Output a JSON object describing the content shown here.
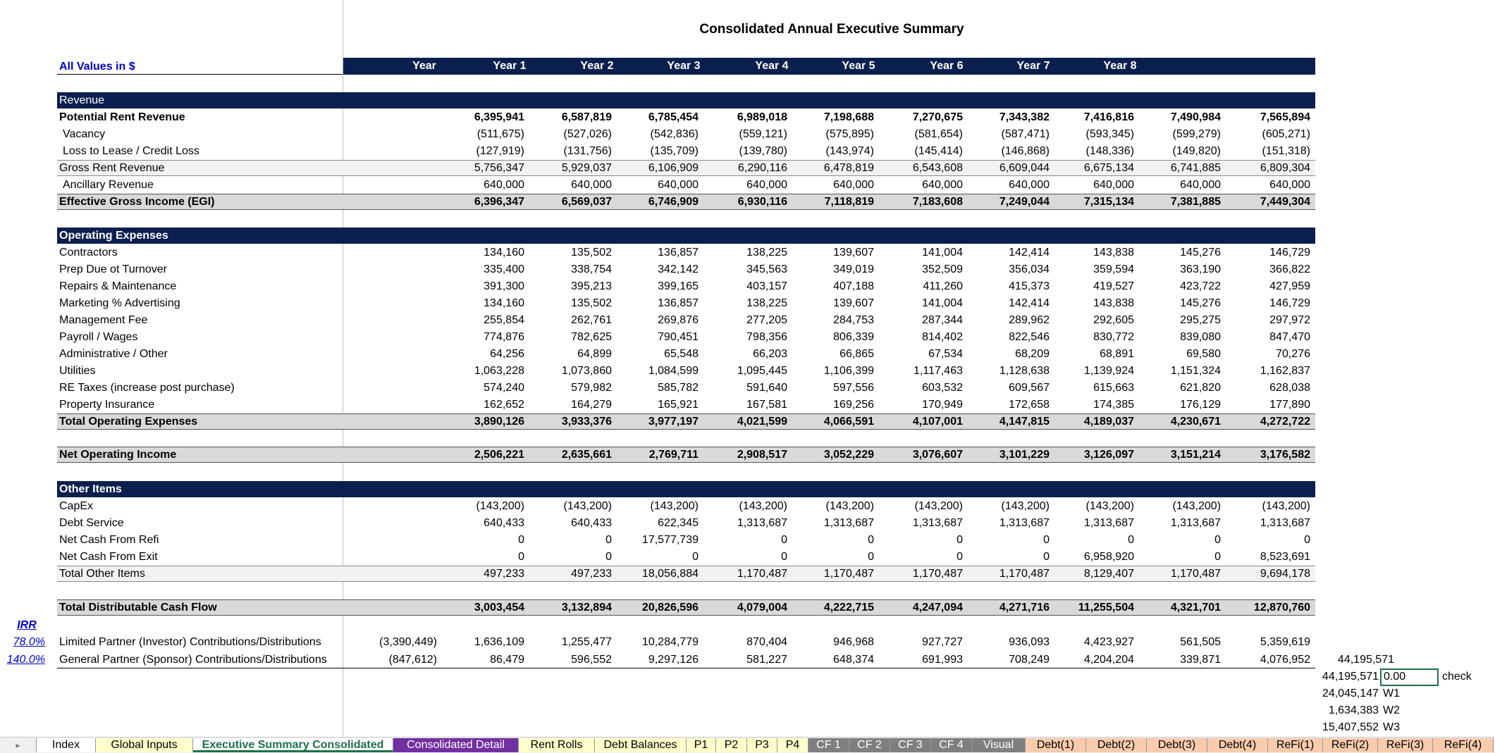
{
  "title": "Consolidated Annual Executive Summary",
  "units_label": "All Values in $",
  "year_header": [
    "Year",
    "Year 1",
    "Year 2",
    "Year 3",
    "Year 4",
    "Year 5",
    "Year 6",
    "Year 7",
    "Year 8"
  ],
  "revenue": {
    "header": "Revenue",
    "rows": [
      {
        "label": "Potential Rent Revenue",
        "values": [
          "6,395,941",
          "6,587,819",
          "6,785,454",
          "6,989,018",
          "7,198,688",
          "7,270,675",
          "7,343,382",
          "7,416,816",
          "7,490,984",
          "7,565,894"
        ]
      },
      {
        "label": "Vacancy",
        "values": [
          "(511,675)",
          "(527,026)",
          "(542,836)",
          "(559,121)",
          "(575,895)",
          "(581,654)",
          "(587,471)",
          "(593,345)",
          "(599,279)",
          "(605,271)"
        ]
      },
      {
        "label": "Loss to Lease / Credit Loss",
        "values": [
          "(127,919)",
          "(131,756)",
          "(135,709)",
          "(139,780)",
          "(143,974)",
          "(145,414)",
          "(146,868)",
          "(148,336)",
          "(149,820)",
          "(151,318)"
        ]
      },
      {
        "label": "Gross Rent Revenue",
        "values": [
          "5,756,347",
          "5,929,037",
          "6,106,909",
          "6,290,116",
          "6,478,819",
          "6,543,608",
          "6,609,044",
          "6,675,134",
          "6,741,885",
          "6,809,304"
        ]
      },
      {
        "label": "Ancillary Revenue",
        "values": [
          "640,000",
          "640,000",
          "640,000",
          "640,000",
          "640,000",
          "640,000",
          "640,000",
          "640,000",
          "640,000",
          "640,000"
        ]
      },
      {
        "label": "Effective Gross Income (EGI)",
        "values": [
          "6,396,347",
          "6,569,037",
          "6,746,909",
          "6,930,116",
          "7,118,819",
          "7,183,608",
          "7,249,044",
          "7,315,134",
          "7,381,885",
          "7,449,304"
        ]
      }
    ]
  },
  "opex": {
    "header": "Operating Expenses",
    "rows": [
      {
        "label": "Contractors",
        "values": [
          "134,160",
          "135,502",
          "136,857",
          "138,225",
          "139,607",
          "141,004",
          "142,414",
          "143,838",
          "145,276",
          "146,729"
        ]
      },
      {
        "label": "Prep Due ot Turnover",
        "values": [
          "335,400",
          "338,754",
          "342,142",
          "345,563",
          "349,019",
          "352,509",
          "356,034",
          "359,594",
          "363,190",
          "366,822"
        ]
      },
      {
        "label": "Repairs & Maintenance",
        "values": [
          "391,300",
          "395,213",
          "399,165",
          "403,157",
          "407,188",
          "411,260",
          "415,373",
          "419,527",
          "423,722",
          "427,959"
        ]
      },
      {
        "label": "Marketing % Advertising",
        "values": [
          "134,160",
          "135,502",
          "136,857",
          "138,225",
          "139,607",
          "141,004",
          "142,414",
          "143,838",
          "145,276",
          "146,729"
        ]
      },
      {
        "label": "Management Fee",
        "values": [
          "255,854",
          "262,761",
          "269,876",
          "277,205",
          "284,753",
          "287,344",
          "289,962",
          "292,605",
          "295,275",
          "297,972"
        ]
      },
      {
        "label": "Payroll / Wages",
        "values": [
          "774,876",
          "782,625",
          "790,451",
          "798,356",
          "806,339",
          "814,402",
          "822,546",
          "830,772",
          "839,080",
          "847,470"
        ]
      },
      {
        "label": "Administrative / Other",
        "values": [
          "64,256",
          "64,899",
          "65,548",
          "66,203",
          "66,865",
          "67,534",
          "68,209",
          "68,891",
          "69,580",
          "70,276"
        ]
      },
      {
        "label": "Utilities",
        "values": [
          "1,063,228",
          "1,073,860",
          "1,084,599",
          "1,095,445",
          "1,106,399",
          "1,117,463",
          "1,128,638",
          "1,139,924",
          "1,151,324",
          "1,162,837"
        ]
      },
      {
        "label": "RE Taxes (increase post purchase)",
        "values": [
          "574,240",
          "579,982",
          "585,782",
          "591,640",
          "597,556",
          "603,532",
          "609,567",
          "615,663",
          "621,820",
          "628,038"
        ]
      },
      {
        "label": "Property Insurance",
        "values": [
          "162,652",
          "164,279",
          "165,921",
          "167,581",
          "169,256",
          "170,949",
          "172,658",
          "174,385",
          "176,129",
          "177,890"
        ]
      },
      {
        "label": "Total Operating Expenses",
        "values": [
          "3,890,126",
          "3,933,376",
          "3,977,197",
          "4,021,599",
          "4,066,591",
          "4,107,001",
          "4,147,815",
          "4,189,037",
          "4,230,671",
          "4,272,722"
        ]
      }
    ]
  },
  "noi": {
    "label": "Net Operating Income",
    "values": [
      "2,506,221",
      "2,635,661",
      "2,769,711",
      "2,908,517",
      "3,052,229",
      "3,076,607",
      "3,101,229",
      "3,126,097",
      "3,151,214",
      "3,176,582"
    ]
  },
  "other": {
    "header": "Other Items",
    "rows": [
      {
        "label": "CapEx",
        "values": [
          "(143,200)",
          "(143,200)",
          "(143,200)",
          "(143,200)",
          "(143,200)",
          "(143,200)",
          "(143,200)",
          "(143,200)",
          "(143,200)",
          "(143,200)"
        ]
      },
      {
        "label": "Debt Service",
        "values": [
          "640,433",
          "640,433",
          "622,345",
          "1,313,687",
          "1,313,687",
          "1,313,687",
          "1,313,687",
          "1,313,687",
          "1,313,687",
          "1,313,687"
        ]
      },
      {
        "label": "Net Cash From Refi",
        "values": [
          "0",
          "0",
          "17,577,739",
          "0",
          "0",
          "0",
          "0",
          "0",
          "0",
          "0"
        ]
      },
      {
        "label": "Net Cash From Exit",
        "values": [
          "0",
          "0",
          "0",
          "0",
          "0",
          "0",
          "0",
          "6,958,920",
          "0",
          "8,523,691"
        ]
      },
      {
        "label": "Total Other Items",
        "values": [
          "497,233",
          "497,233",
          "18,056,884",
          "1,170,487",
          "1,170,487",
          "1,170,487",
          "1,170,487",
          "8,129,407",
          "1,170,487",
          "9,694,178"
        ]
      }
    ]
  },
  "tdcf": {
    "label": "Total Distributable Cash Flow",
    "values": [
      "3,003,454",
      "3,132,894",
      "20,826,596",
      "4,079,004",
      "4,222,715",
      "4,247,094",
      "4,271,716",
      "11,255,504",
      "4,321,701",
      "12,870,760"
    ]
  },
  "irr": {
    "header": "IRR",
    "lp": {
      "irr": "78.0%",
      "label": "Limited Partner (Investor) Contributions/Distributions",
      "year0": "(3,390,449)",
      "values": [
        "1,636,109",
        "1,255,477",
        "10,284,779",
        "870,404",
        "946,968",
        "927,727",
        "936,093",
        "4,423,927",
        "561,505",
        "5,359,619"
      ]
    },
    "gp": {
      "irr": "140.0%",
      "label": "General Partner (Sponsor) Contributions/Distributions",
      "year0": "(847,612)",
      "values": [
        "86,479",
        "596,552",
        "9,297,126",
        "581,227",
        "648,374",
        "691,993",
        "708,249",
        "4,204,204",
        "339,871",
        "4,076,952"
      ]
    }
  },
  "side": {
    "gp_total": "44,195,571",
    "check_total": "44,195,571",
    "check_value": "0.00",
    "check_label": "check",
    "w_rows": [
      {
        "value": "24,045,147",
        "label": "W1"
      },
      {
        "value": "1,634,383",
        "label": "W2"
      },
      {
        "value": "15,407,552",
        "label": "W3"
      }
    ]
  },
  "tabs": [
    {
      "label": "Index",
      "bg": "#ffffff",
      "fg": "#000000"
    },
    {
      "label": "Global Inputs",
      "bg": "#ffffcc",
      "fg": "#000000"
    },
    {
      "label": "Executive Summary Consolidated",
      "bg": "#ffffff",
      "fg": "#1e7145",
      "active": true
    },
    {
      "label": "Consolidated Detail",
      "bg": "#7030a0",
      "fg": "#ffffff"
    },
    {
      "label": "Rent Rolls",
      "bg": "#ffffcc",
      "fg": "#000000"
    },
    {
      "label": "Debt Balances",
      "bg": "#ffffcc",
      "fg": "#000000"
    },
    {
      "label": "P1",
      "bg": "#ffffcc",
      "fg": "#000000"
    },
    {
      "label": "P2",
      "bg": "#ffffcc",
      "fg": "#000000"
    },
    {
      "label": "P3",
      "bg": "#ffffcc",
      "fg": "#000000"
    },
    {
      "label": "P4",
      "bg": "#ffffcc",
      "fg": "#000000"
    },
    {
      "label": "CF 1",
      "bg": "#7f7f7f",
      "fg": "#ffffff"
    },
    {
      "label": "CF 2",
      "bg": "#7f7f7f",
      "fg": "#ffffff"
    },
    {
      "label": "CF 3",
      "bg": "#7f7f7f",
      "fg": "#ffffff"
    },
    {
      "label": "CF 4",
      "bg": "#7f7f7f",
      "fg": "#ffffff"
    },
    {
      "label": "Visual",
      "bg": "#7f7f7f",
      "fg": "#ffffff"
    },
    {
      "label": "Debt(1)",
      "bg": "#f8cbad",
      "fg": "#000000"
    },
    {
      "label": "Debt(2)",
      "bg": "#f8cbad",
      "fg": "#000000"
    },
    {
      "label": "Debt(3)",
      "bg": "#f8cbad",
      "fg": "#000000"
    },
    {
      "label": "Debt(4)",
      "bg": "#f8cbad",
      "fg": "#000000"
    },
    {
      "label": "ReFi(1)",
      "bg": "#f8cbad",
      "fg": "#000000"
    },
    {
      "label": "ReFi(2)",
      "bg": "#f8cbad",
      "fg": "#000000"
    },
    {
      "label": "ReFi(3)",
      "bg": "#f8cbad",
      "fg": "#000000"
    },
    {
      "label": "ReFi(4)",
      "bg": "#f8cbad",
      "fg": "#000000"
    }
  ],
  "colors": {
    "navy": "#0b1f4e",
    "total_fill": "#d9d9d9",
    "link_blue": "#0000cc",
    "active_tab_text": "#1e7145"
  }
}
